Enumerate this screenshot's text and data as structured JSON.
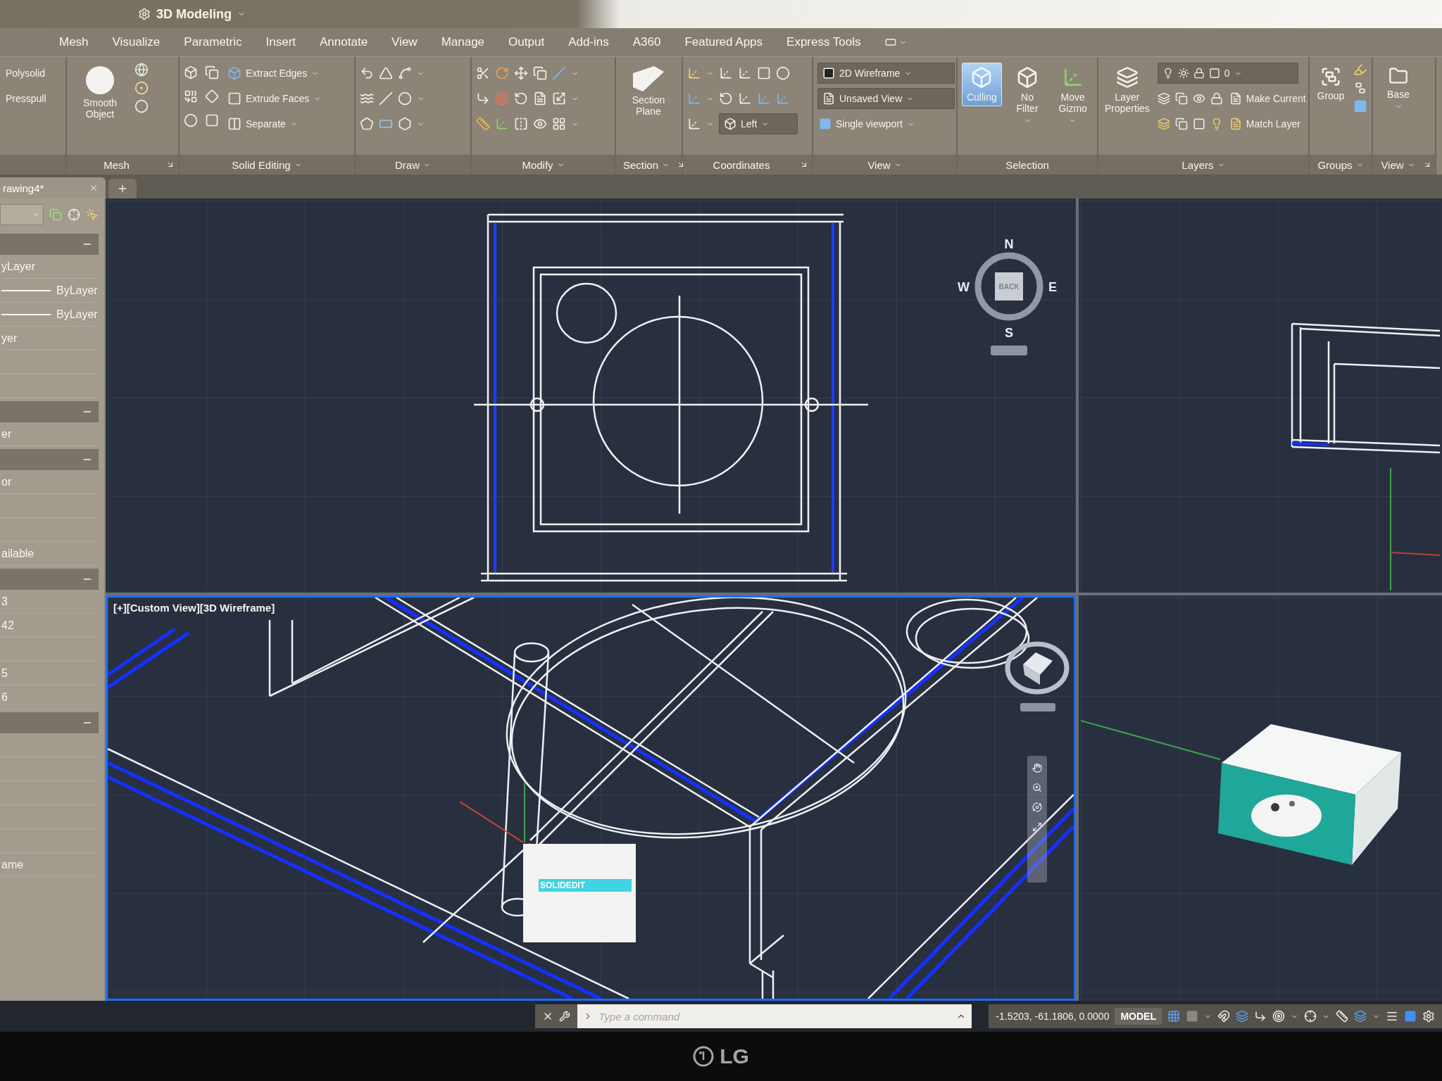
{
  "title_bar": {
    "workspace": "3D Modeling"
  },
  "ribbon_tabs": [
    {
      "label": "Mesh",
      "selected": false
    },
    {
      "label": "Visualize",
      "selected": false
    },
    {
      "label": "Parametric",
      "selected": false
    },
    {
      "label": "Insert",
      "selected": false
    },
    {
      "label": "Annotate",
      "selected": false
    },
    {
      "label": "View",
      "selected": false
    },
    {
      "label": "Manage",
      "selected": false
    },
    {
      "label": "Output",
      "selected": false
    },
    {
      "label": "Add-ins",
      "selected": false
    },
    {
      "label": "A360",
      "selected": false
    },
    {
      "label": "Featured Apps",
      "selected": false
    },
    {
      "label": "Express Tools",
      "selected": false
    }
  ],
  "ribbon_panels": [
    {
      "kind": "modeling",
      "menu": false,
      "launcher": false,
      "items": [
        {
          "label": "Polysolid",
          "menu": false
        },
        {
          "label": "Presspull",
          "menu": false
        }
      ]
    },
    {
      "kind": "mesh",
      "title": "Mesh",
      "menu": false,
      "launcher": true,
      "items": [
        {
          "label": "Smooth Object",
          "menu": false
        }
      ]
    },
    {
      "kind": "solidedit",
      "title": "Solid Editing",
      "menu": true,
      "launcher": false,
      "items": [
        {
          "label": "Extract Edges",
          "menu": true
        },
        {
          "label": "Extrude Faces",
          "menu": true
        },
        {
          "label": "Separate",
          "menu": true
        }
      ]
    },
    {
      "kind": "draw",
      "title": "Draw",
      "menu": true,
      "launcher": false
    },
    {
      "kind": "modify",
      "title": "Modify",
      "menu": true,
      "launcher": false
    },
    {
      "kind": "section",
      "title": "Section",
      "menu": true,
      "launcher": true,
      "items": [
        {
          "label": "Section Plane",
          "menu": false
        }
      ]
    },
    {
      "kind": "coordinates",
      "title": "Coordinates",
      "menu": false,
      "launcher": true,
      "items": [
        {
          "label": "Left",
          "menu": true
        }
      ]
    },
    {
      "kind": "view",
      "title": "View",
      "menu": true,
      "launcher": false,
      "items": [
        {
          "label": "2D Wireframe",
          "menu": true
        },
        {
          "label": "Unsaved View",
          "menu": true
        },
        {
          "label": "Single viewport",
          "menu": true
        }
      ]
    },
    {
      "kind": "selection",
      "title": "Selection",
      "menu": false,
      "launcher": false,
      "items": [
        {
          "label": "Culling",
          "on": true,
          "menu": false
        },
        {
          "label": "No Filter",
          "on": false,
          "menu": true
        },
        {
          "label": "Move Gizmo",
          "on": false,
          "menu": true
        }
      ]
    },
    {
      "kind": "layers",
      "title": "Layers",
      "menu": true,
      "launcher": false,
      "items": [
        {
          "label": "Layer Properties",
          "menu": false
        },
        {
          "label": "0",
          "menu": true
        },
        {
          "label": "Make Current",
          "menu": false
        },
        {
          "label": "Match Layer",
          "menu": false
        }
      ]
    },
    {
      "kind": "groups",
      "title": "Groups",
      "menu": true,
      "launcher": false,
      "items": [
        {
          "label": "Group",
          "menu": false
        }
      ]
    },
    {
      "kind": "base",
      "title": "View",
      "menu": true,
      "launcher": true,
      "items": [
        {
          "label": "Base",
          "menu": true
        }
      ]
    }
  ],
  "file_tabs": [
    {
      "label": "rawing4*",
      "selected": true
    }
  ],
  "properties_palette": {
    "sections": [
      {
        "expanded": true,
        "rows": [
          {
            "kind": "text",
            "text": "yLayer"
          },
          {
            "kind": "line",
            "text": "ByLayer"
          },
          {
            "kind": "line",
            "text": "ByLayer"
          },
          {
            "kind": "text",
            "text": "yer"
          },
          {
            "kind": "empty"
          },
          {
            "kind": "empty"
          }
        ]
      },
      {
        "expanded": true,
        "rows": [
          {
            "kind": "text",
            "text": "er"
          }
        ]
      },
      {
        "expanded": true,
        "rows": [
          {
            "kind": "text",
            "text": "or"
          },
          {
            "kind": "empty"
          },
          {
            "kind": "empty"
          },
          {
            "kind": "text",
            "text": "ailable"
          }
        ]
      },
      {
        "expanded": true,
        "rows": [
          {
            "kind": "text",
            "text": "3"
          },
          {
            "kind": "text",
            "text": "42"
          },
          {
            "kind": "empty"
          },
          {
            "kind": "text",
            "text": "5"
          },
          {
            "kind": "text",
            "text": "6"
          }
        ]
      },
      {
        "expanded": true,
        "rows": [
          {
            "kind": "empty"
          },
          {
            "kind": "empty"
          },
          {
            "kind": "empty"
          },
          {
            "kind": "empty"
          },
          {
            "kind": "empty"
          },
          {
            "kind": "text",
            "text": "ame"
          }
        ]
      }
    ]
  },
  "viewports": [
    {
      "kind": "top",
      "active": false,
      "compass": {
        "north": "N",
        "east": "E",
        "south": "S",
        "west": "W",
        "cube_face": "BACK"
      }
    },
    {
      "kind": "right",
      "active": false
    },
    {
      "kind": "iso",
      "active": true,
      "label": "[+][Custom View][3D Wireframe]",
      "suggestions": [
        {
          "text": "SOLIDEDIT",
          "selected": true
        }
      ]
    },
    {
      "kind": "shaded",
      "active": false
    }
  ],
  "command_line": {
    "placeholder": "Type a command"
  },
  "status_bar": {
    "coordinates": "-1.5203, -61.1806, 0.0000",
    "model": "MODEL"
  },
  "monitor": {
    "brand": "LG"
  }
}
